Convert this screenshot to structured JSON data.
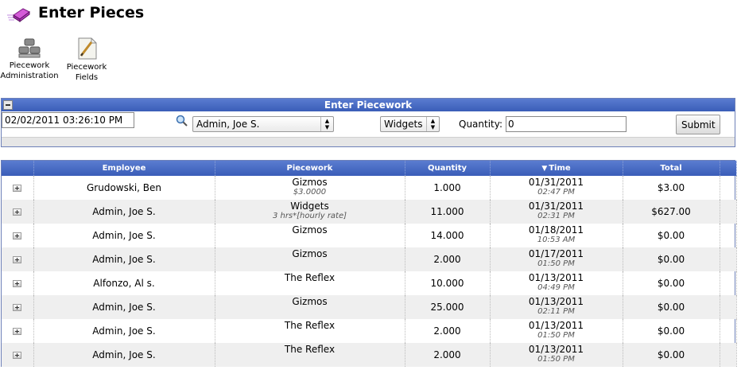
{
  "page": {
    "title": "Enter Pieces"
  },
  "toolbar": {
    "admin_label_line1": "Piecework",
    "admin_label_line2": "Administration",
    "fields_label_line1": "Piecework",
    "fields_label_line2": "Fields"
  },
  "form": {
    "header": "Enter Piecework",
    "datetime_value": "02/02/2011 03:26:10 PM",
    "employee_selected": "Admin, Joe S.",
    "piecework_selected": "Widgets",
    "quantity_label": "Quantity:",
    "quantity_value": "0",
    "submit_label": "Submit"
  },
  "table": {
    "columns": [
      "",
      "Employee",
      "Piecework",
      "Quantity",
      "Time",
      "Total",
      ""
    ],
    "sort_column": "Time",
    "sort_indicator": "▼",
    "rows": [
      {
        "employee": "Grudowski, Ben",
        "piecework": "Gizmos",
        "piecework_sub": "$3.0000",
        "quantity": "1.000",
        "date": "01/31/2011",
        "time": "02:47 PM",
        "total": "$3.00"
      },
      {
        "employee": "Admin, Joe S.",
        "piecework": "Widgets",
        "piecework_sub": "3 hrs*[hourly rate]",
        "quantity": "11.000",
        "date": "01/31/2011",
        "time": "02:31 PM",
        "total": "$627.00"
      },
      {
        "employee": "Admin, Joe S.",
        "piecework": "Gizmos",
        "piecework_sub": "",
        "quantity": "14.000",
        "date": "01/18/2011",
        "time": "10:53 AM",
        "total": "$0.00"
      },
      {
        "employee": "Admin, Joe S.",
        "piecework": "Gizmos",
        "piecework_sub": "",
        "quantity": "2.000",
        "date": "01/17/2011",
        "time": "01:50 PM",
        "total": "$0.00"
      },
      {
        "employee": "Alfonzo, Al s.",
        "piecework": "The Reflex",
        "piecework_sub": "",
        "quantity": "10.000",
        "date": "01/13/2011",
        "time": "04:49 PM",
        "total": "$0.00"
      },
      {
        "employee": "Admin, Joe S.",
        "piecework": "Gizmos",
        "piecework_sub": "",
        "quantity": "25.000",
        "date": "01/13/2011",
        "time": "02:11 PM",
        "total": "$0.00"
      },
      {
        "employee": "Admin, Joe S.",
        "piecework": "The Reflex",
        "piecework_sub": "",
        "quantity": "2.000",
        "date": "01/13/2011",
        "time": "01:50 PM",
        "total": "$0.00"
      },
      {
        "employee": "Admin, Joe S.",
        "piecework": "The Reflex",
        "piecework_sub": "",
        "quantity": "2.000",
        "date": "01/13/2011",
        "time": "01:50 PM",
        "total": "$0.00"
      }
    ]
  }
}
